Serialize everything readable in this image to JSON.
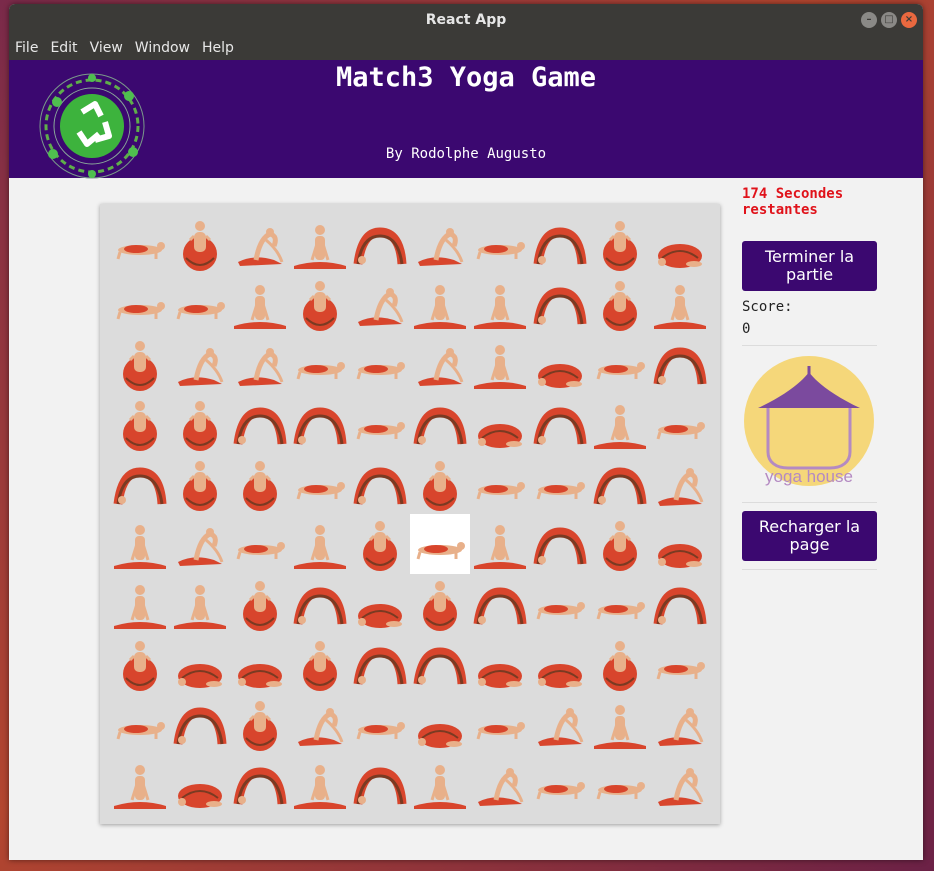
{
  "window": {
    "title": "React App"
  },
  "menu": [
    "File",
    "Edit",
    "View",
    "Window",
    "Help"
  ],
  "header": {
    "title": "Match3 Yoga Game",
    "author": "By Rodolphe Augusto"
  },
  "board": {
    "selected": [
      5,
      5
    ],
    "pose_types": [
      "plank",
      "lotus-ball",
      "pigeon",
      "seated-split",
      "wheel",
      "child"
    ],
    "rows": [
      [
        0,
        1,
        2,
        3,
        4,
        2,
        0,
        4,
        1,
        5
      ],
      [
        0,
        0,
        3,
        1,
        2,
        3,
        3,
        4,
        1,
        3
      ],
      [
        1,
        2,
        2,
        0,
        0,
        2,
        3,
        5,
        0,
        4
      ],
      [
        1,
        1,
        4,
        4,
        0,
        4,
        5,
        4,
        3,
        0
      ],
      [
        4,
        1,
        1,
        0,
        4,
        1,
        0,
        0,
        4,
        2
      ],
      [
        3,
        2,
        0,
        3,
        1,
        0,
        3,
        4,
        1,
        5
      ],
      [
        3,
        3,
        1,
        4,
        5,
        1,
        4,
        0,
        0,
        4
      ],
      [
        1,
        5,
        5,
        1,
        4,
        4,
        5,
        5,
        1,
        0
      ],
      [
        0,
        4,
        1,
        2,
        0,
        5,
        0,
        2,
        3,
        2
      ],
      [
        3,
        5,
        4,
        3,
        4,
        3,
        2,
        0,
        0,
        2
      ]
    ]
  },
  "sidebar": {
    "timer_text": "174 Secondes restantes",
    "end_button": "Terminer la partie",
    "score_label": "Score:",
    "score_value": "0",
    "sponsor_text": "yoga house",
    "reload_button": "Recharger la page"
  },
  "colors": {
    "header": "#3b0870",
    "button": "#3b0870",
    "timer": "#e0121a",
    "sponsor_circle": "#f5d77a",
    "sponsor_accent": "#7b4a9e"
  }
}
